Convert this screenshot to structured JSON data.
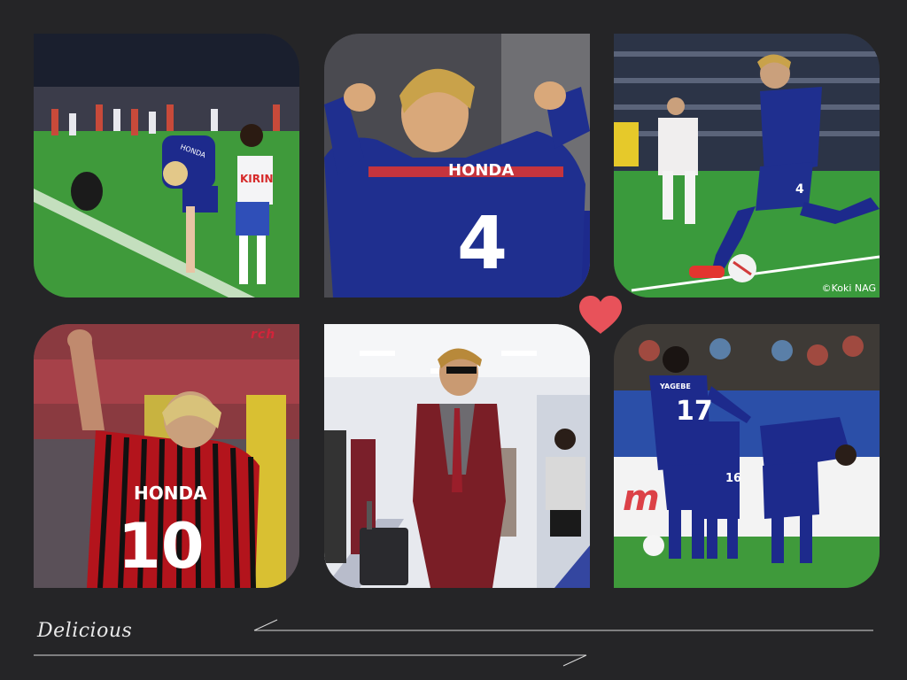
{
  "caption": "Delicious",
  "tiles": {
    "tile1": {
      "jersey_name": "HONDA",
      "kid_shirt": "KIRIN"
    },
    "tile2": {
      "jersey_name": "HONDA",
      "jersey_number": "4"
    },
    "tile3": {
      "jersey_number": "4",
      "credit": "©Koki NAG"
    },
    "tile4": {
      "jersey_name": "HONDA",
      "jersey_number": "10",
      "watermark": "rch"
    },
    "tile6": {
      "jersey_name": "YAGEBE",
      "jersey_number": "17",
      "number_2": "16"
    }
  },
  "colors": {
    "background": "#252527",
    "heart": "#e8525a",
    "japan_blue": "#1d2a8c",
    "milan_red": "#b3141c",
    "pitch_green": "#3f9a3b"
  },
  "icons": [
    "heart-icon"
  ]
}
